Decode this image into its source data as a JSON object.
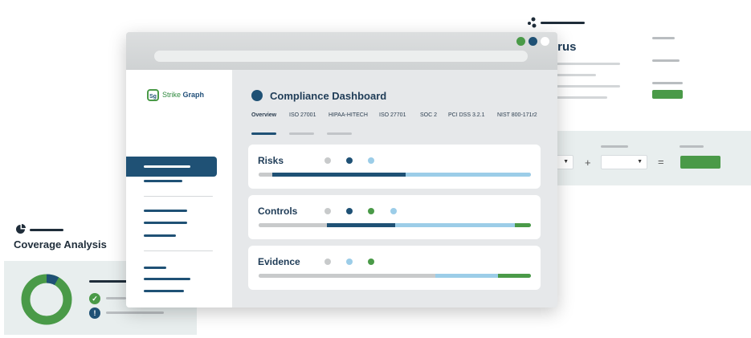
{
  "colors": {
    "navy": "#1f5175",
    "green": "#4a9a48",
    "light_blue": "#9ccde8",
    "gray": "#c8cacb",
    "line_gray": "#c2c5c8"
  },
  "back_panel": {
    "title": "irus",
    "icon": "network-icon",
    "calculator": {
      "plus": "+",
      "equals": "="
    }
  },
  "coverage": {
    "title": "Coverage Analysis",
    "icon": "pie-chart-icon",
    "donut": {
      "green_fraction": 0.92,
      "navy_fraction": 0.08
    },
    "status_icons": [
      "check-icon",
      "exclamation-icon"
    ]
  },
  "window": {
    "logo": {
      "mark": "Sg",
      "brand_part1": "Strike ",
      "brand_part2": "Graph"
    },
    "title": "Compliance Dashboard",
    "tabs": [
      {
        "label": "Overview",
        "active": true
      },
      {
        "label": "ISO 27001",
        "active": false
      },
      {
        "label": "HIPAA-HITECH",
        "active": false
      },
      {
        "label": "ISO 27701",
        "active": false
      },
      {
        "label": "SOC 2",
        "active": false
      },
      {
        "label": "PCI DSS 3.2.1",
        "active": false
      },
      {
        "label": "NIST 800-171r2",
        "active": false
      }
    ],
    "cards": [
      {
        "title": "Risks",
        "legend": [
          "gray",
          "navy",
          "light_blue"
        ],
        "progress": [
          {
            "color": "gray",
            "fraction": 0.05
          },
          {
            "color": "navy",
            "fraction": 0.49
          },
          {
            "color": "light_blue",
            "fraction": 0.46
          }
        ]
      },
      {
        "title": "Controls",
        "legend": [
          "gray",
          "navy",
          "green",
          "light_blue"
        ],
        "progress": [
          {
            "color": "gray",
            "fraction": 0.25
          },
          {
            "color": "navy",
            "fraction": 0.25
          },
          {
            "color": "light_blue",
            "fraction": 0.44
          },
          {
            "color": "green",
            "fraction": 0.06
          }
        ]
      },
      {
        "title": "Evidence",
        "legend": [
          "gray",
          "light_blue",
          "green"
        ],
        "progress": [
          {
            "color": "gray",
            "fraction": 0.65
          },
          {
            "color": "light_blue",
            "fraction": 0.23
          },
          {
            "color": "green",
            "fraction": 0.12
          }
        ]
      }
    ]
  }
}
